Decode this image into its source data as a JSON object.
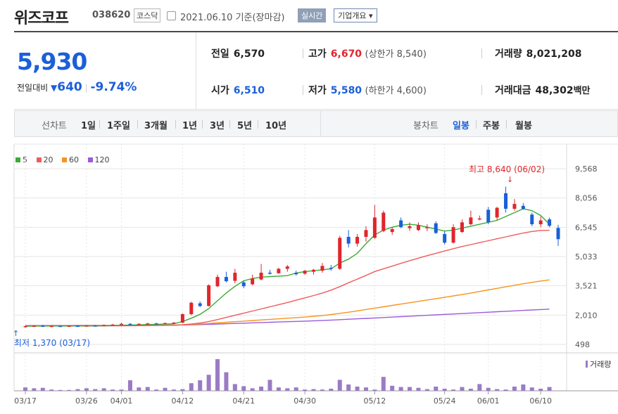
{
  "header": {
    "name": "위즈코프",
    "code": "038620",
    "market": "코스닥",
    "date": "2021.06.10 기준(장마감)",
    "realtime_label": "실시간",
    "company_info_label": "기업개요 ▾"
  },
  "summary": {
    "current_price": "5,930",
    "change_label": "전일대비",
    "change_value": "640",
    "change_rate": "-9.74%",
    "prev_label": "전일",
    "prev": "6,570",
    "high_label": "고가",
    "high": "6,670",
    "upper_limit": "(상한가 8,540)",
    "volume_label": "거래량",
    "volume": "8,021,208",
    "open_label": "시가",
    "open": "6,510",
    "low_label": "저가",
    "low": "5,580",
    "lower_limit": "(하한가 4,600)",
    "amount_label": "거래대금",
    "amount": "48,302",
    "amount_unit": "백만"
  },
  "toolbar": {
    "line_chart_label": "선차트",
    "ranges": [
      "1일",
      "1주일",
      "3개월",
      "1년",
      "3년",
      "5년",
      "10년"
    ],
    "candle_label": "봉차트",
    "periods": [
      "일봉",
      "주봉",
      "월봉"
    ],
    "active_period": "일봉"
  },
  "legend": [
    {
      "label": "5",
      "color": "#3aaa35"
    },
    {
      "label": "20",
      "color": "#ef5b5b"
    },
    {
      "label": "60",
      "color": "#f7941d"
    },
    {
      "label": "120",
      "color": "#9c5bd9"
    }
  ],
  "colors": {
    "up": "#e0262c",
    "down": "#1b5fd9",
    "grid": "#e6e6e6",
    "volume": "#9b7bc4"
  },
  "chart_data": {
    "type": "candlestick",
    "y_ticks": [
      "9,568",
      "8,056",
      "6,545",
      "5,033",
      "3,521",
      "2,010",
      "498"
    ],
    "y_range": [
      498,
      9568
    ],
    "x_ticks": [
      "03/17",
      "03/26",
      "04/01",
      "04/12",
      "04/21",
      "04/30",
      "05/12",
      "05/24",
      "06/01",
      "06/10"
    ],
    "x_tick_index": [
      0,
      7,
      11,
      18,
      25,
      32,
      40,
      48,
      53,
      59
    ],
    "high_annotation": "최고 8,640 (06/02)",
    "low_annotation": "최저 1,370 (03/17)",
    "volume_legend": "거래량",
    "candles": [
      {
        "o": 1390,
        "h": 1470,
        "l": 1370,
        "c": 1440
      },
      {
        "o": 1440,
        "h": 1500,
        "l": 1420,
        "c": 1460
      },
      {
        "o": 1460,
        "h": 1520,
        "l": 1430,
        "c": 1440
      },
      {
        "o": 1440,
        "h": 1480,
        "l": 1410,
        "c": 1450
      },
      {
        "o": 1450,
        "h": 1470,
        "l": 1420,
        "c": 1440
      },
      {
        "o": 1440,
        "h": 1480,
        "l": 1420,
        "c": 1460
      },
      {
        "o": 1460,
        "h": 1490,
        "l": 1430,
        "c": 1450
      },
      {
        "o": 1450,
        "h": 1480,
        "l": 1430,
        "c": 1470
      },
      {
        "o": 1470,
        "h": 1500,
        "l": 1440,
        "c": 1460
      },
      {
        "o": 1460,
        "h": 1520,
        "l": 1440,
        "c": 1500
      },
      {
        "o": 1500,
        "h": 1560,
        "l": 1480,
        "c": 1520
      },
      {
        "o": 1520,
        "h": 1620,
        "l": 1490,
        "c": 1560
      },
      {
        "o": 1560,
        "h": 1600,
        "l": 1520,
        "c": 1540
      },
      {
        "o": 1540,
        "h": 1590,
        "l": 1520,
        "c": 1560
      },
      {
        "o": 1560,
        "h": 1610,
        "l": 1530,
        "c": 1580
      },
      {
        "o": 1580,
        "h": 1620,
        "l": 1540,
        "c": 1560
      },
      {
        "o": 1560,
        "h": 1620,
        "l": 1540,
        "c": 1600
      },
      {
        "o": 1600,
        "h": 1660,
        "l": 1560,
        "c": 1620
      },
      {
        "o": 1620,
        "h": 2100,
        "l": 1600,
        "c": 2060
      },
      {
        "o": 2060,
        "h": 2700,
        "l": 2000,
        "c": 2650
      },
      {
        "o": 2620,
        "h": 2720,
        "l": 2420,
        "c": 2480
      },
      {
        "o": 2480,
        "h": 3600,
        "l": 2460,
        "c": 3550
      },
      {
        "o": 3500,
        "h": 4100,
        "l": 3450,
        "c": 3980
      },
      {
        "o": 3980,
        "h": 4250,
        "l": 3700,
        "c": 3760
      },
      {
        "o": 3780,
        "h": 4400,
        "l": 3650,
        "c": 4200
      },
      {
        "o": 3700,
        "h": 3800,
        "l": 3400,
        "c": 3500
      },
      {
        "o": 3600,
        "h": 4100,
        "l": 3550,
        "c": 3900
      },
      {
        "o": 3850,
        "h": 4650,
        "l": 3800,
        "c": 4200
      },
      {
        "o": 4200,
        "h": 4350,
        "l": 4100,
        "c": 4180
      },
      {
        "o": 4170,
        "h": 4450,
        "l": 4150,
        "c": 4400
      },
      {
        "o": 4400,
        "h": 4600,
        "l": 4250,
        "c": 4520
      },
      {
        "o": 4200,
        "h": 4300,
        "l": 4050,
        "c": 4120
      },
      {
        "o": 4150,
        "h": 4350,
        "l": 4100,
        "c": 4300
      },
      {
        "o": 4250,
        "h": 4400,
        "l": 4100,
        "c": 4350
      },
      {
        "o": 4300,
        "h": 4700,
        "l": 4200,
        "c": 4550
      },
      {
        "o": 4450,
        "h": 4600,
        "l": 4300,
        "c": 4400
      },
      {
        "o": 4400,
        "h": 6100,
        "l": 4350,
        "c": 6000
      },
      {
        "o": 6050,
        "h": 6400,
        "l": 5500,
        "c": 5700
      },
      {
        "o": 5700,
        "h": 6200,
        "l": 5550,
        "c": 6050
      },
      {
        "o": 6050,
        "h": 6600,
        "l": 5800,
        "c": 6400
      },
      {
        "o": 6000,
        "h": 7700,
        "l": 5950,
        "c": 7050
      },
      {
        "o": 6350,
        "h": 7400,
        "l": 6300,
        "c": 7300
      },
      {
        "o": 6300,
        "h": 6550,
        "l": 6150,
        "c": 6450
      },
      {
        "o": 6900,
        "h": 7050,
        "l": 6500,
        "c": 6550
      },
      {
        "o": 6500,
        "h": 6800,
        "l": 6350,
        "c": 6600
      },
      {
        "o": 6400,
        "h": 6800,
        "l": 6350,
        "c": 6650
      },
      {
        "o": 6500,
        "h": 6700,
        "l": 6350,
        "c": 6550
      },
      {
        "o": 6750,
        "h": 6850,
        "l": 6200,
        "c": 6250
      },
      {
        "o": 6200,
        "h": 6350,
        "l": 5650,
        "c": 5750
      },
      {
        "o": 5750,
        "h": 6700,
        "l": 5700,
        "c": 6550
      },
      {
        "o": 6300,
        "h": 6950,
        "l": 6250,
        "c": 6800
      },
      {
        "o": 6700,
        "h": 7400,
        "l": 6650,
        "c": 7050
      },
      {
        "o": 7000,
        "h": 7150,
        "l": 6900,
        "c": 7000
      },
      {
        "o": 7450,
        "h": 7600,
        "l": 6700,
        "c": 6800
      },
      {
        "o": 7050,
        "h": 7600,
        "l": 6900,
        "c": 7550
      },
      {
        "o": 8300,
        "h": 8640,
        "l": 7300,
        "c": 7500
      },
      {
        "o": 7500,
        "h": 8000,
        "l": 7400,
        "c": 7750
      },
      {
        "o": 7650,
        "h": 7800,
        "l": 7450,
        "c": 7500
      },
      {
        "o": 7200,
        "h": 7300,
        "l": 6600,
        "c": 6700
      },
      {
        "o": 6700,
        "h": 7100,
        "l": 6550,
        "c": 6900
      },
      {
        "o": 6950,
        "h": 7050,
        "l": 6550,
        "c": 6620
      },
      {
        "o": 6510,
        "h": 6670,
        "l": 5580,
        "c": 5930
      }
    ],
    "ma5": [
      1440,
      1450,
      1450,
      1448,
      1447,
      1450,
      1452,
      1454,
      1458,
      1463,
      1472,
      1485,
      1496,
      1508,
      1523,
      1533,
      1546,
      1566,
      1680,
      1850,
      2050,
      2350,
      2750,
      3150,
      3500,
      3780,
      3900,
      3970,
      4000,
      4020,
      4050,
      4180,
      4260,
      4300,
      4350,
      4400,
      4700,
      4900,
      5200,
      5700,
      6150,
      6400,
      6550,
      6650,
      6700,
      6650,
      6550,
      6450,
      6350,
      6400,
      6500,
      6600,
      6700,
      6800,
      6900,
      7100,
      7300,
      7500,
      7400,
      7150,
      6700
    ],
    "ma20": [
      1440,
      1445,
      1448,
      1448,
      1448,
      1448,
      1449,
      1450,
      1451,
      1452,
      1455,
      1459,
      1463,
      1467,
      1471,
      1476,
      1481,
      1488,
      1510,
      1550,
      1600,
      1680,
      1780,
      1890,
      2000,
      2110,
      2220,
      2330,
      2440,
      2550,
      2660,
      2780,
      2900,
      3020,
      3150,
      3300,
      3480,
      3680,
      3870,
      4060,
      4260,
      4400,
      4540,
      4680,
      4820,
      4950,
      5080,
      5200,
      5320,
      5440,
      5550,
      5650,
      5750,
      5850,
      5950,
      6050,
      6150,
      6250,
      6330,
      6380,
      6390
    ],
    "ma60": [
      1450,
      1452,
      1454,
      1456,
      1458,
      1460,
      1462,
      1464,
      1466,
      1468,
      1470,
      1473,
      1476,
      1479,
      1482,
      1486,
      1490,
      1495,
      1510,
      1530,
      1555,
      1580,
      1610,
      1640,
      1670,
      1700,
      1730,
      1760,
      1790,
      1820,
      1850,
      1880,
      1910,
      1950,
      1990,
      2040,
      2100,
      2160,
      2230,
      2300,
      2370,
      2440,
      2510,
      2580,
      2650,
      2720,
      2790,
      2860,
      2930,
      3000,
      3070,
      3150,
      3230,
      3310,
      3390,
      3470,
      3550,
      3630,
      3700,
      3770,
      3830
    ],
    "ma120": [
      1470,
      1471,
      1472,
      1473,
      1474,
      1475,
      1476,
      1477,
      1478,
      1479,
      1480,
      1482,
      1484,
      1486,
      1488,
      1490,
      1492,
      1494,
      1500,
      1510,
      1522,
      1535,
      1550,
      1565,
      1580,
      1595,
      1610,
      1625,
      1640,
      1655,
      1670,
      1685,
      1700,
      1718,
      1736,
      1754,
      1775,
      1796,
      1818,
      1840,
      1862,
      1885,
      1908,
      1931,
      1954,
      1977,
      2000,
      2023,
      2046,
      2069,
      2092,
      2115,
      2138,
      2161,
      2184,
      2207,
      2230,
      2253,
      2276,
      2299,
      2320
    ],
    "volume": [
      8,
      6,
      7,
      3,
      2,
      2,
      4,
      6,
      4,
      6,
      3,
      3,
      25,
      8,
      9,
      3,
      7,
      3,
      4,
      18,
      25,
      38,
      75,
      44,
      16,
      11,
      6,
      10,
      26,
      8,
      6,
      8,
      3,
      4,
      3,
      5,
      26,
      15,
      10,
      8,
      3,
      33,
      12,
      9,
      9,
      7,
      4,
      10,
      5,
      3,
      9,
      5,
      16,
      7,
      4,
      3,
      10,
      15,
      8,
      5,
      9
    ]
  }
}
